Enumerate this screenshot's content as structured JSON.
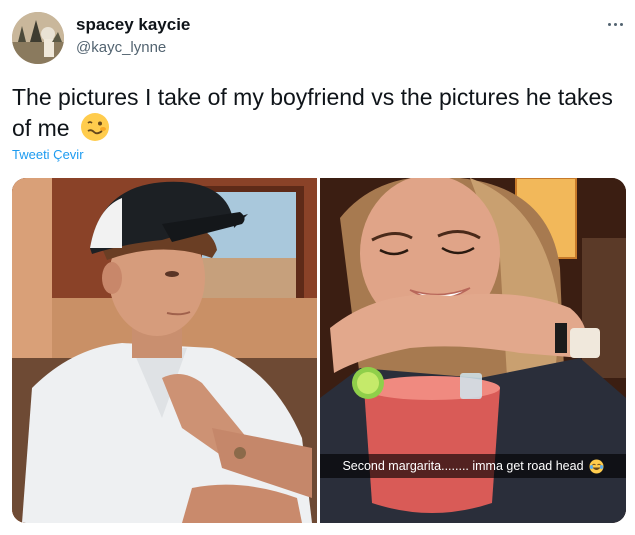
{
  "tweet": {
    "display_name": "spacey kaycie",
    "handle": "@kayc_lynne",
    "text": "The pictures I take of my boyfriend vs the pictures he takes of me",
    "text_emoji": "woozy-face-emoji",
    "translate_label": "Tweeti Çevir",
    "more_icon": "more-options-icon"
  },
  "media": {
    "right_photo_caption": "Second margarita........ imma get road head",
    "caption_emoji": "laughing-face-emoji"
  },
  "colors": {
    "link": "#1d9bf0",
    "handle_gray": "#536471",
    "text": "#0f1419"
  }
}
